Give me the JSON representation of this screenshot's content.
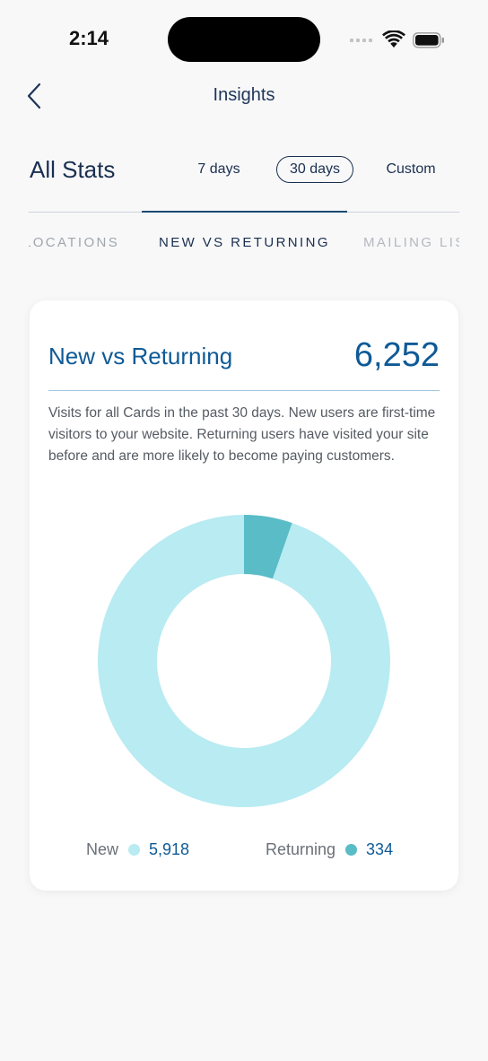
{
  "status_bar": {
    "time": "2:14"
  },
  "header": {
    "title": "Insights",
    "back_icon": "chevron-left-icon"
  },
  "stats": {
    "heading": "All Stats",
    "ranges": [
      "7 days",
      "30 days",
      "Custom"
    ],
    "selected_range": "30 days"
  },
  "tabs": {
    "items": [
      "LOCATIONS",
      "NEW VS RETURNING",
      "MAILING LIST"
    ],
    "active": "NEW VS RETURNING"
  },
  "card": {
    "title": "New vs Returning",
    "total": "6,252",
    "description": "Visits for all Cards in the past 30 days. New users are first-time visitors to your website. Returning users have visited your site before and are more likely to become paying customers."
  },
  "colors": {
    "new": "#b8ebf2",
    "returning": "#59bcc6",
    "accent": "#0f5a96",
    "text_dark": "#1a2f4f"
  },
  "chart_data": {
    "type": "pie",
    "donut": true,
    "categories": [
      "New",
      "Returning"
    ],
    "values": [
      5918,
      334
    ],
    "value_labels": [
      "5,918",
      "334"
    ],
    "colors": [
      "#b8ebf2",
      "#59bcc6"
    ],
    "legend": "bottom"
  }
}
